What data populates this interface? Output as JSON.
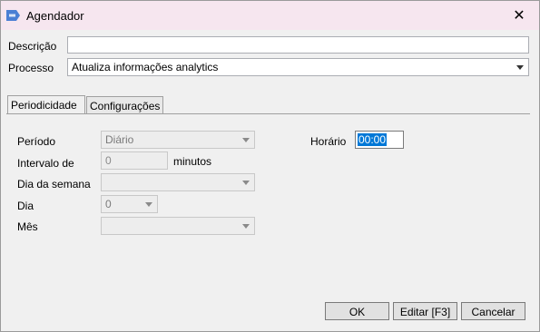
{
  "window": {
    "title": "Agendador",
    "close_glyph": "✕"
  },
  "form": {
    "descricao_label": "Descrição",
    "descricao_value": "",
    "processo_label": "Processo",
    "processo_value": "Atualiza informações analytics"
  },
  "tabs": [
    {
      "label": "Periodicidade",
      "selected": true
    },
    {
      "label": "Configurações",
      "selected": false
    }
  ],
  "periodicidade": {
    "periodo_label": "Período",
    "periodo_value": "Diário",
    "intervalo_label": "Intervalo de",
    "intervalo_value": "0",
    "intervalo_unit": "minutos",
    "dia_semana_label": "Dia da semana",
    "dia_semana_value": "",
    "dia_label": "Dia",
    "dia_value": "0",
    "mes_label": "Mês",
    "mes_value": "",
    "horario_label": "Horário",
    "horario_value": "00:00"
  },
  "buttons": {
    "ok_label": "OK",
    "editar_label": "Editar [F3]",
    "cancelar_label": "Cancelar"
  },
  "colors": {
    "title_bg": "#f6e6ef",
    "selection": "#0078d7",
    "app_icon": "#4a7fd4"
  }
}
